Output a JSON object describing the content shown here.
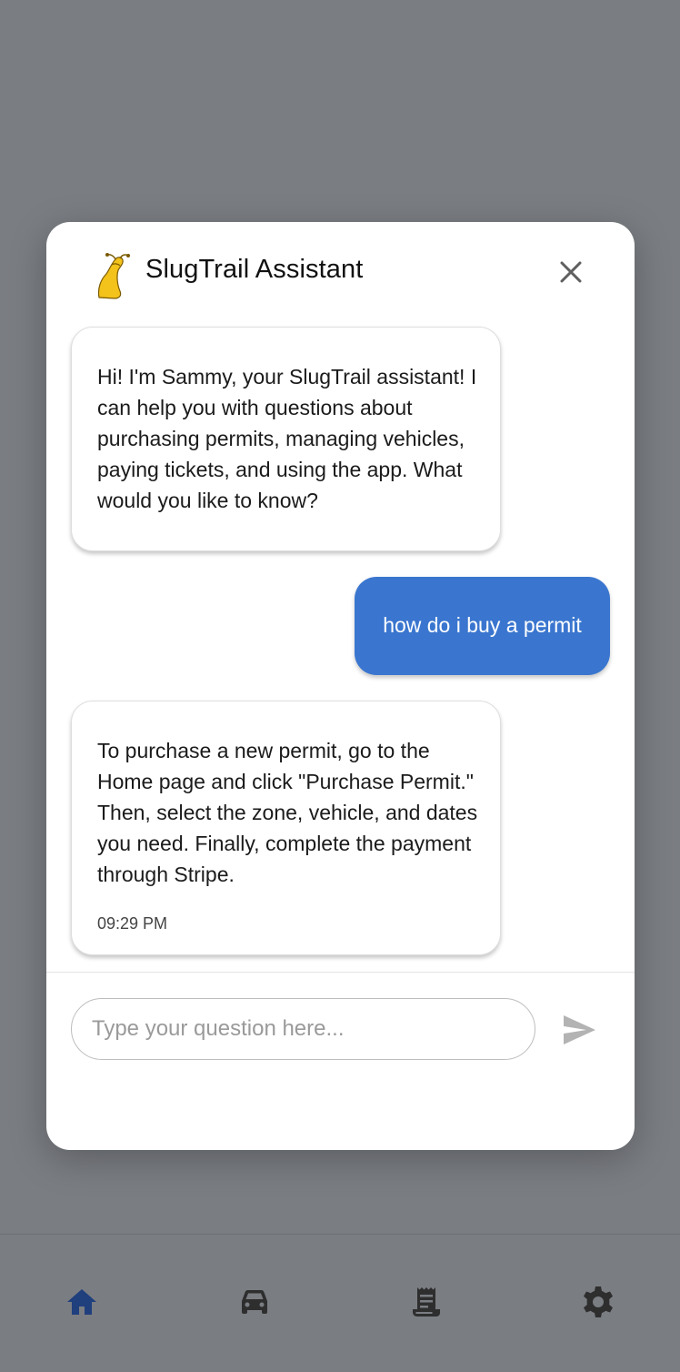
{
  "dialog": {
    "title": "SlugTrail Assistant",
    "avatar_icon": "slug-mascot-icon",
    "close_icon": "close-icon"
  },
  "messages": [
    {
      "sender": "assistant",
      "text": "Hi! I'm Sammy, your SlugTrail assistant! I can help you with questions about purchasing permits, managing vehicles, paying tickets, and using the app. What would you like to know?"
    },
    {
      "sender": "user",
      "text": "how do i buy a permit"
    },
    {
      "sender": "assistant",
      "text": "To purchase a new permit, go to the Home page and click \"Purchase Permit.\" Then, select the zone, vehicle, and dates you need. Finally, complete the payment through Stripe.",
      "time": "09:29 PM"
    }
  ],
  "composer": {
    "placeholder": "Type your question here...",
    "value": "",
    "send_icon": "send-icon"
  },
  "bottom_nav": {
    "items": [
      {
        "icon": "home-icon",
        "active": true
      },
      {
        "icon": "car-icon",
        "active": false
      },
      {
        "icon": "receipt-icon",
        "active": false
      },
      {
        "icon": "settings-gear-icon",
        "active": false
      }
    ]
  },
  "colors": {
    "overlay": "#7a7d82",
    "user_bubble": "#3a76cf",
    "active_nav": "#1f3f7d",
    "inactive_nav": "#2e2e2e"
  }
}
